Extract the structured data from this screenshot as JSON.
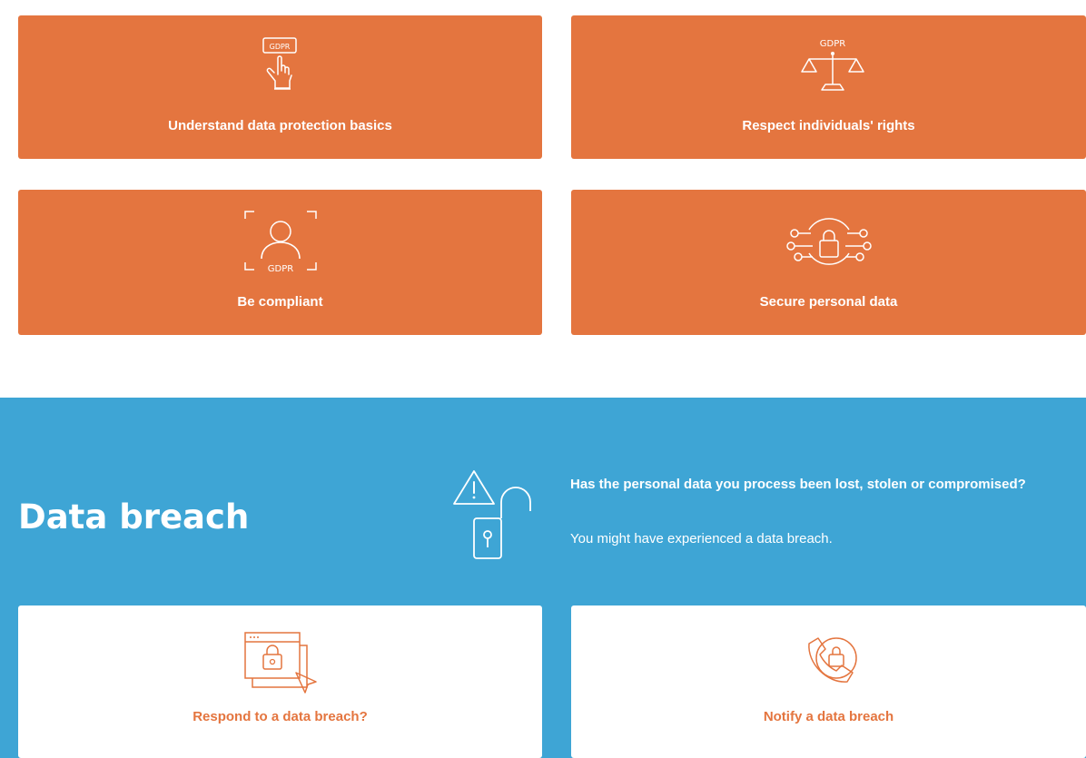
{
  "tiles": [
    {
      "label": "Understand data protection basics",
      "icon": "gdpr-hand-tap-icon",
      "icon_text": "GDPR"
    },
    {
      "label": "Respect individuals' rights",
      "icon": "gdpr-scales-icon",
      "icon_text": "GDPR"
    },
    {
      "label": "Be compliant",
      "icon": "gdpr-person-scan-icon",
      "icon_text": "GDPR"
    },
    {
      "label": "Secure personal data",
      "icon": "network-lock-icon"
    }
  ],
  "breach": {
    "title": "Data breach",
    "question": "Has the personal data you process been lost, stolen or compromised?",
    "note": "You might have experienced a data breach.",
    "icon": "warning-unlocked-padlock-icon",
    "cards": [
      {
        "label": "Respond to a data breach?",
        "icon": "browser-lock-cursor-icon"
      },
      {
        "label": "Notify a data breach",
        "icon": "phone-lock-icon"
      }
    ]
  },
  "colors": {
    "orange": "#e4753f",
    "blue": "#3ea5d5",
    "white": "#ffffff"
  }
}
